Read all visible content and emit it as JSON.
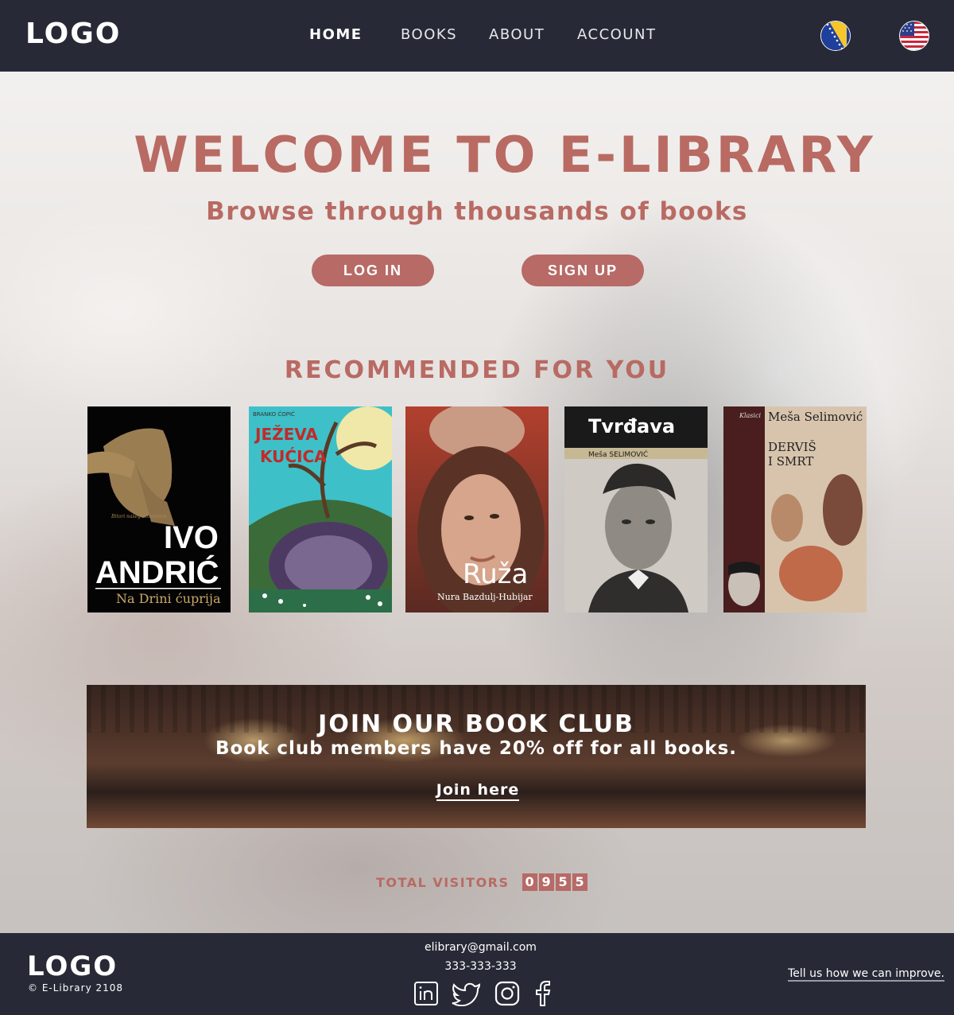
{
  "header": {
    "logo": "LOGO",
    "nav": [
      {
        "label": "HOME"
      },
      {
        "label": "BOOKS"
      },
      {
        "label": "ABOUT"
      },
      {
        "label": "ACCOUNT"
      }
    ],
    "flags": [
      "bosnia-flag-icon",
      "usa-flag-icon"
    ]
  },
  "hero": {
    "title": "WELCOME TO E-LIBRARY",
    "subtitle": "Browse through thousands of books",
    "login_label": "LOG IN",
    "signup_label": "SIGN UP"
  },
  "recommended": {
    "title": "RECOMMENDED FOR YOU",
    "books": [
      {
        "top_text": "Bitori našeg nobelovca",
        "title_line1": "IVO",
        "title_line2": "ANDRIĆ",
        "subtitle": "Na Drini ćuprija"
      },
      {
        "author": "BRANKO ĆOPIĆ",
        "title_line1": "JEŽEVA",
        "title_line2": "KUĆICA"
      },
      {
        "title_line1": "Ruža",
        "author": "Nura Bazdulj-Hubijar"
      },
      {
        "title_line1": "Tvrđava",
        "author": "Meša SELIMOVIĆ"
      },
      {
        "series": "Klasici",
        "author": "Meša Selimović",
        "title_line1": "DERVIŠ",
        "title_line2": "I SMRT"
      }
    ]
  },
  "club": {
    "title": "JOIN OUR BOOK CLUB",
    "subtitle": "Book club members have 20% off for all books.",
    "link": "Join here"
  },
  "visitors": {
    "label": "TOTAL VISITORS",
    "digits": [
      "0",
      "9",
      "5",
      "5"
    ]
  },
  "footer": {
    "logo": "LOGO",
    "copyright": "© E-Library 2108",
    "email": "elibrary@gmail.com",
    "phone": "333-333-333",
    "socials": [
      "linkedin-icon",
      "twitter-icon",
      "instagram-icon",
      "facebook-icon"
    ],
    "feedback": "Tell us how we can improve."
  },
  "colors": {
    "accent": "#b76a66",
    "dark": "#272a36"
  }
}
